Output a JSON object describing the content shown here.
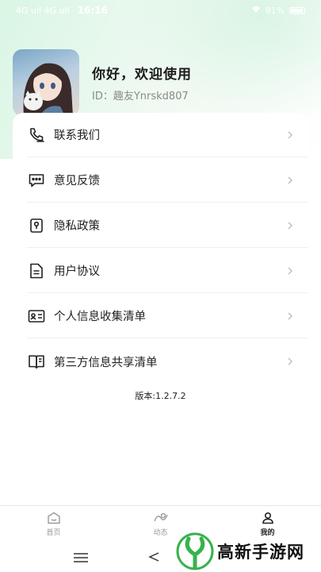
{
  "status_bar": {
    "left": "4G ull 4G ull",
    "time": "16:16",
    "battery": "91%"
  },
  "profile": {
    "greeting": "你好，欢迎使用",
    "user_id": "ID：趣友Ynrskd807"
  },
  "menu": {
    "items": [
      {
        "label": "联系我们",
        "icon": "phone-icon"
      },
      {
        "label": "意见反馈",
        "icon": "chat-bubble-icon"
      },
      {
        "label": "隐私政策",
        "icon": "privacy-lock-icon"
      },
      {
        "label": "用户协议",
        "icon": "document-icon"
      },
      {
        "label": "个人信息收集清单",
        "icon": "id-card-icon"
      },
      {
        "label": "第三方信息共享清单",
        "icon": "book-icon"
      }
    ]
  },
  "version": "版本:1.2.7.2",
  "tabbar": {
    "home": "首页",
    "feed": "动态",
    "mine": "我的"
  },
  "watermark": {
    "text": "高新手游网"
  },
  "colors": {
    "accent_green": "#d9f6e4",
    "logo_green": "#37b24d"
  }
}
